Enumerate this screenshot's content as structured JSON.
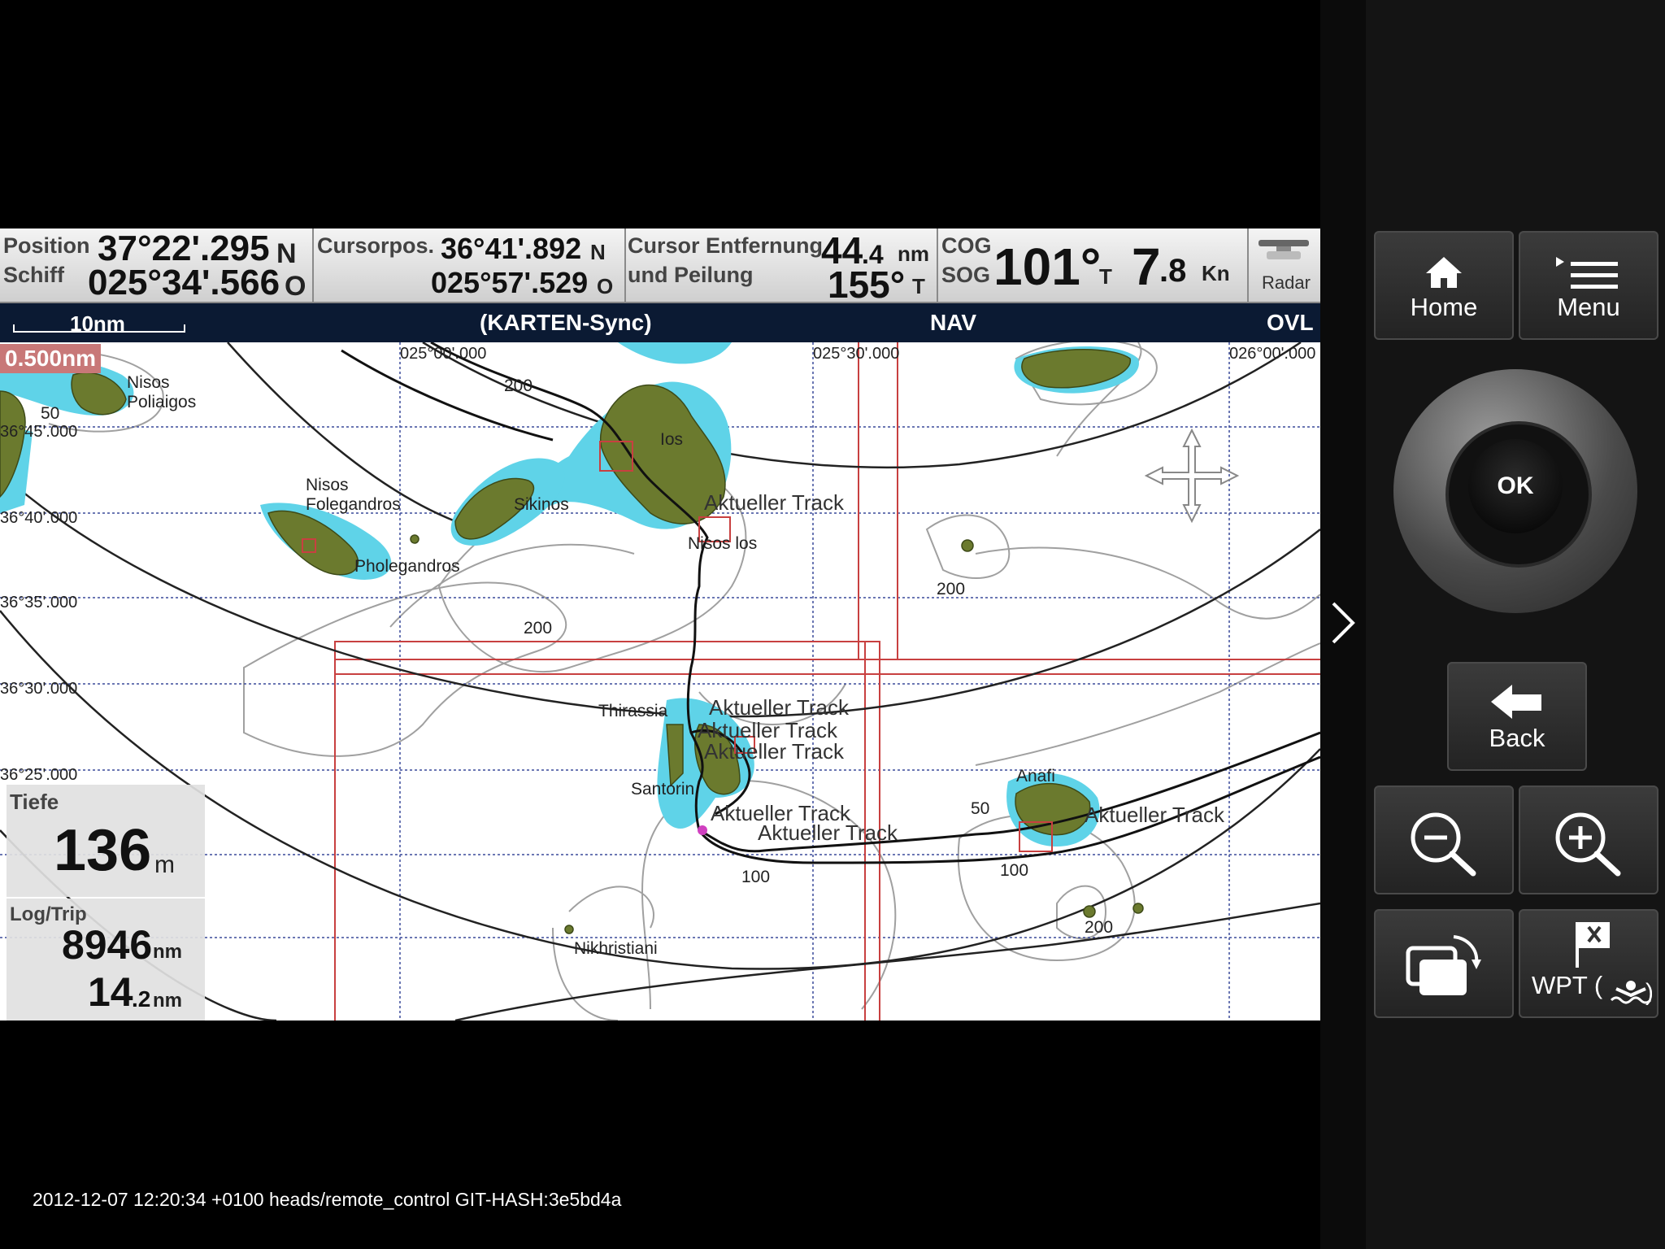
{
  "databar": {
    "position": {
      "label1": "Position",
      "label2": "Schiff",
      "lat": "37°22'.295",
      "lat_h": "N",
      "lon": "025°34'.566",
      "lon_h": "O"
    },
    "cursorpos": {
      "label": "Cursorpos.",
      "lat": "36°41'.892",
      "lat_h": "N",
      "lon": "025°57'.529",
      "lon_h": "O"
    },
    "cursor_range": {
      "label1": "Cursor Entfernung",
      "label2": "und Peilung",
      "dist_big": "44",
      "dist_small": ".4",
      "dist_unit": "nm",
      "bearing": "155°",
      "bearing_ref": "T"
    },
    "cog_sog": {
      "cog_label": "COG",
      "sog_label": "SOG",
      "cog": "101°",
      "cog_ref": "T",
      "sog_big": "7",
      "sog_small": ".8",
      "sog_unit": "Kn"
    },
    "radar": {
      "label": "Radar"
    }
  },
  "chart_header": {
    "scale": "10nm",
    "mode": "(KARTEN-Sync)",
    "nav": "NAV",
    "ovl": "OVL"
  },
  "chart": {
    "range_badge": "0.500nm",
    "lon_labels": [
      "025°00'.000",
      "025°30'.000",
      "026°00'.000"
    ],
    "lat_labels": [
      "36°45'.000",
      "36°40'.000",
      "36°35'.000",
      "36°30'.000",
      "36°25'.000"
    ],
    "place_labels": {
      "poliaigos": "Nisos\nPoliaigos",
      "folegandros": "Nisos\nFolegandros",
      "pholegandros": "Pholegandros",
      "sikinos": "Sikinos",
      "ios": "Ios",
      "nisos_ios": "Nisos los",
      "thirassia": "Thirassia",
      "santorin": "Santorin",
      "anafi": "Anafi",
      "christiani": "Nikhristiani"
    },
    "track_label": "Aktueller Track",
    "depth_labels": [
      "200",
      "200",
      "200",
      "200",
      "100",
      "100",
      "200",
      "50",
      "50"
    ]
  },
  "depth_panel": {
    "tiefe_label": "Tiefe",
    "tiefe_value": "136",
    "tiefe_unit": "m",
    "log_label": "Log/Trip",
    "log_value": "8946",
    "log_unit": "nm",
    "trip_big": "14",
    "trip_small": ".2",
    "trip_unit": "nm"
  },
  "side": {
    "home": "Home",
    "menu": "Menu",
    "ok": "OK",
    "back": "Back",
    "wpt": "WPT ("
  },
  "footer": {
    "text": "2012-12-07 12:20:34 +0100 heads/remote_control GIT-HASH:3e5bd4a"
  },
  "colors": {
    "land": "#6b7a2e",
    "shallow": "#5fd3e8",
    "track": "#111111",
    "grid": "#3a4a9a",
    "contour": "#9a9a9a",
    "chart_lines": "#c03030"
  }
}
